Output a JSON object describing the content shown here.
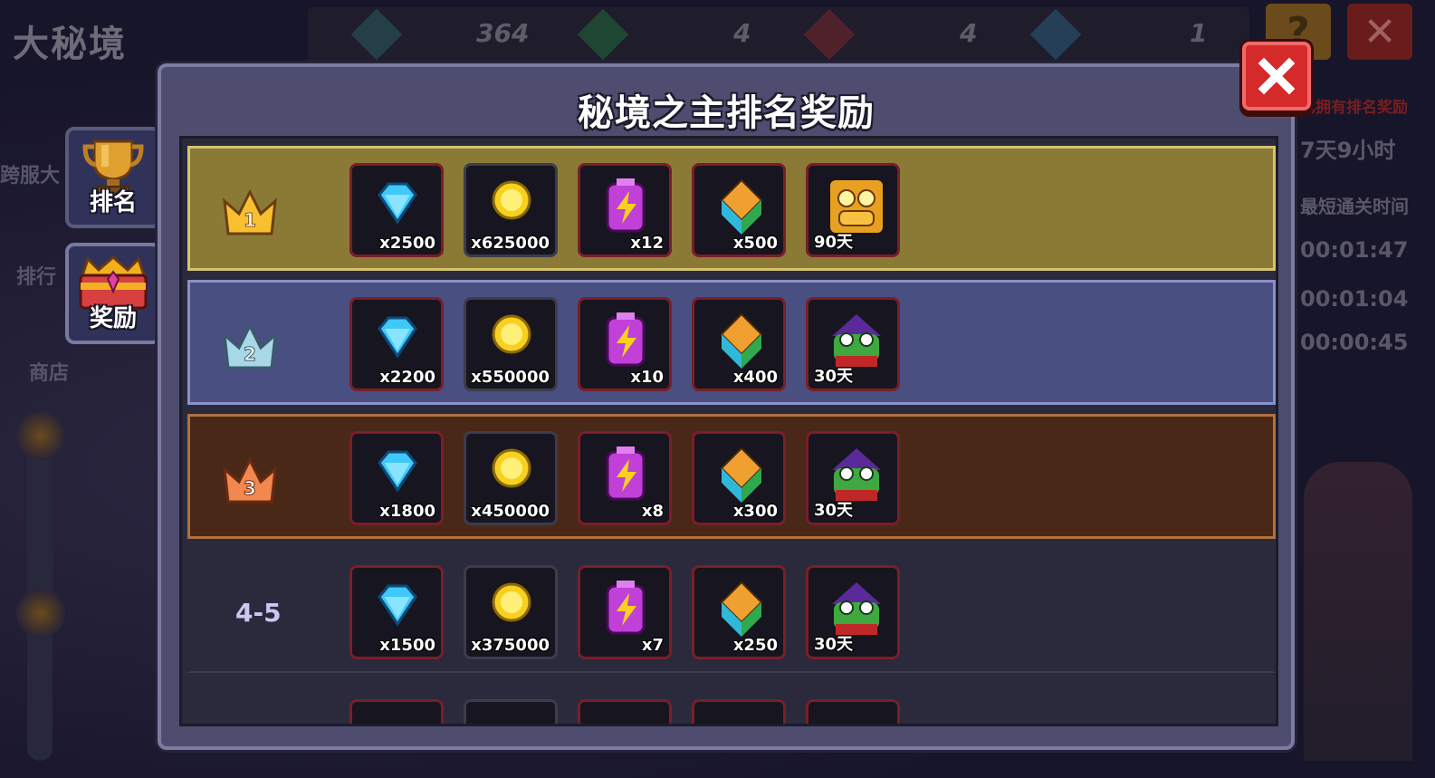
{
  "background": {
    "title": "大秘境",
    "stats": [
      "364",
      "4",
      "4",
      "1"
    ],
    "sidebar_labels": [
      "跨服大",
      "排行",
      "商店"
    ],
    "right_red_text": "已拥有排名奖励",
    "right_timer": "7天9小时",
    "right_label": "最短通关时间",
    "right_times": [
      "00:01:47",
      "00:01:04",
      "00:00:45"
    ]
  },
  "tabs": {
    "rank_label": "排名",
    "reward_label": "奖励"
  },
  "panel": {
    "title": "秘境之主排名奖励"
  },
  "rows": [
    {
      "rank": "1",
      "diamond": "x2500",
      "coin": "x625000",
      "energy": "x12",
      "crystal": "x500",
      "avatar": "90天"
    },
    {
      "rank": "2",
      "diamond": "x2200",
      "coin": "x550000",
      "energy": "x10",
      "crystal": "x400",
      "avatar": "30天"
    },
    {
      "rank": "3",
      "diamond": "x1800",
      "coin": "x450000",
      "energy": "x8",
      "crystal": "x300",
      "avatar": "30天"
    },
    {
      "rank": "4-5",
      "diamond": "x1500",
      "coin": "x375000",
      "energy": "x7",
      "crystal": "x250",
      "avatar": "30天"
    }
  ],
  "colors": {
    "gold_row": "#8a7a36",
    "silver_row": "#4a4f82",
    "bronze_row": "#4a2818",
    "close": "#d42a2a"
  }
}
